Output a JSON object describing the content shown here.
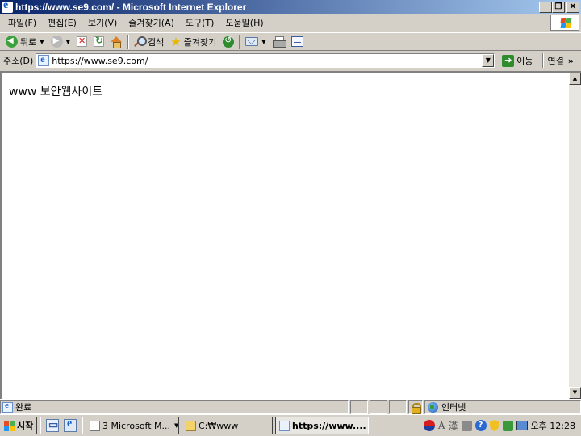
{
  "window": {
    "title": "https://www.se9.com/ - Microsoft Internet Explorer",
    "controls": {
      "minimize": "_",
      "restore": "❐",
      "close": "✕"
    }
  },
  "menu": [
    "파일(F)",
    "편집(E)",
    "보기(V)",
    "즐겨찾기(A)",
    "도구(T)",
    "도움말(H)"
  ],
  "toolbar": {
    "back_label": "뒤로",
    "search_label": "검색",
    "favorites_label": "즐겨찾기"
  },
  "address": {
    "label": "주소(D)",
    "url": "https://www.se9.com/",
    "go_label": "이동",
    "links_label": "연결"
  },
  "content": {
    "text": "www 보안웹사이트"
  },
  "status": {
    "text": "완료",
    "zone": "인터넷"
  },
  "taskbar": {
    "start_label": "시작",
    "tasks": [
      "3 Microsoft M...",
      "C:₩www",
      "https://www...."
    ],
    "ime": {
      "mode": "A",
      "hanja": "漢"
    },
    "clock": "오후 12:28"
  }
}
